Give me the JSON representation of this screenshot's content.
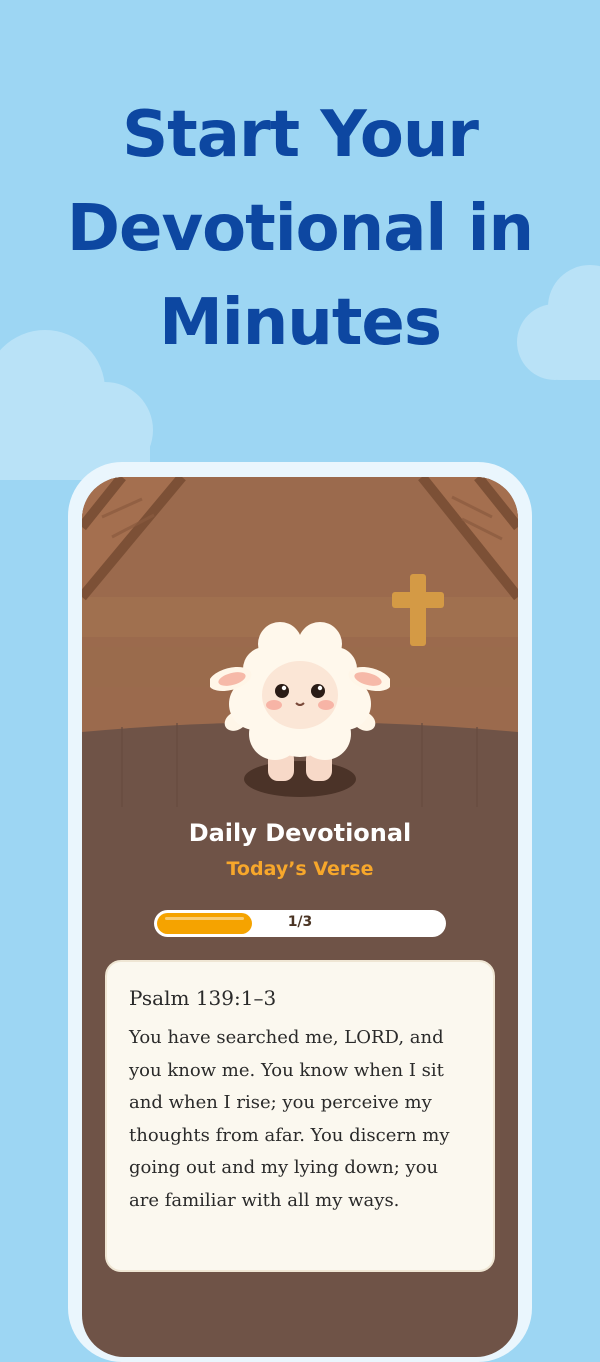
{
  "headline": {
    "line1": "Start Your",
    "line2": "Devotional in",
    "line3": "Minutes"
  },
  "devotional": {
    "title": "Daily Devotional",
    "subtitle": "Today’s Verse",
    "progress": {
      "label": "1/3",
      "fraction": 0.333
    }
  },
  "verse": {
    "reference": "Psalm 139:1–3",
    "text": "You have searched me, LORD, and you know me. You know when I sit and when I rise; you perceive my thoughts from afar. You discern my going out and my lying down; you are familiar with all my ways."
  },
  "icons": [
    "cross-icon",
    "sheep-mascot"
  ],
  "colors": {
    "background": "#9dd6f3",
    "headline": "#0d47a1",
    "accent": "#f5a300",
    "room": "#6f5347"
  }
}
